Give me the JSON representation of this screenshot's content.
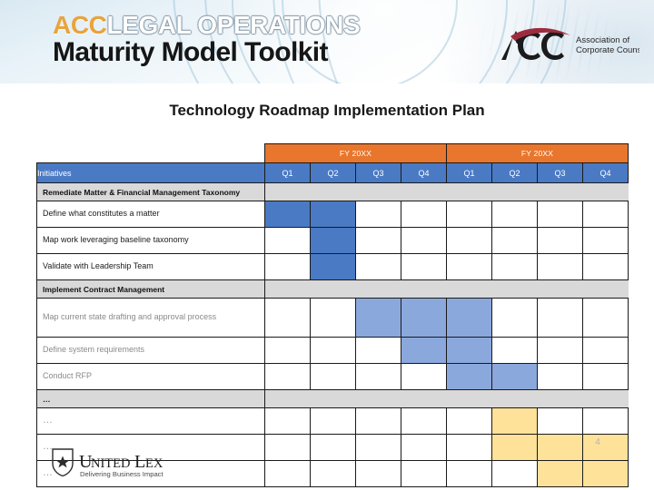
{
  "banner": {
    "brand_acc": "ACC",
    "brand_legalops": "LEGAL OPERATIONS",
    "brand_line2": "Maturity Model Toolkit",
    "logo_mark": "ACC",
    "logo_tagline_line1": "Association of",
    "logo_tagline_line2": "Corporate Counsel"
  },
  "slide": {
    "title": "Technology Roadmap Implementation Plan",
    "page_number": "4"
  },
  "table": {
    "fy_labels": [
      "FY 20XX",
      "FY 20XX"
    ],
    "initiatives_header": "Initiatives",
    "quarters": [
      "Q1",
      "Q2",
      "Q3",
      "Q4",
      "Q1",
      "Q2",
      "Q3",
      "Q4"
    ],
    "sections": [
      {
        "title": "Remediate Matter & Financial Management Taxonomy",
        "muted": false,
        "rows": [
          {
            "label": "Define what constitutes a matter",
            "fills": [
              "blue",
              "blue",
              "",
              "",
              "",
              "",
              "",
              ""
            ]
          },
          {
            "label": "Map work leveraging baseline taxonomy",
            "fills": [
              "",
              "blue",
              "",
              "",
              "",
              "",
              "",
              ""
            ]
          },
          {
            "label": "Validate with Leadership Team",
            "fills": [
              "",
              "blue",
              "",
              "",
              "",
              "",
              "",
              ""
            ]
          }
        ]
      },
      {
        "title": "Implement Contract Management",
        "muted": true,
        "rows": [
          {
            "label": "Map current state drafting and approval process",
            "tall": true,
            "fills": [
              "",
              "",
              "lblue",
              "lblue",
              "lblue",
              "",
              "",
              ""
            ]
          },
          {
            "label": "Define system requirements",
            "fills": [
              "",
              "",
              "",
              "lblue",
              "lblue",
              "",
              "",
              ""
            ]
          },
          {
            "label": "Conduct RFP",
            "fills": [
              "",
              "",
              "",
              "",
              "lblue",
              "lblue",
              "",
              ""
            ]
          }
        ]
      },
      {
        "title": "…",
        "dots": true,
        "rows": [
          {
            "label": "…",
            "fills": [
              "",
              "",
              "",
              "",
              "",
              "yellow",
              "",
              ""
            ]
          },
          {
            "label": "…",
            "fills": [
              "",
              "",
              "",
              "",
              "",
              "yellow",
              "yellow",
              "yellow"
            ]
          },
          {
            "label": "…",
            "fills": [
              "",
              "",
              "",
              "",
              "",
              "",
              "yellow",
              "yellow"
            ]
          }
        ]
      }
    ]
  },
  "footer": {
    "logo_name_united": "U",
    "logo_name_nited": "NITED",
    "logo_name_l": "L",
    "logo_name_ex": "EX",
    "logo_tagline": "Delivering Business Impact"
  },
  "colors": {
    "header_blue": "#4a7ac4",
    "fy_orange": "#e8762d",
    "section_gray": "#d9d9d9",
    "fill_blue": "#4a7ac4",
    "fill_light_blue": "#8ba8dd",
    "fill_yellow": "#ffe29a"
  }
}
